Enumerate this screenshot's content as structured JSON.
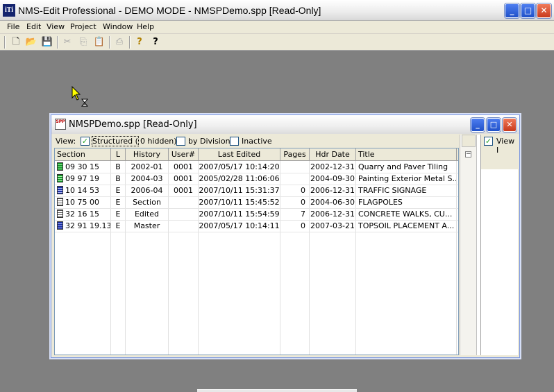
{
  "window": {
    "title": "NMS-Edit Professional - DEMO MODE - NMSPDemo.spp [Read-Only]",
    "app_icon_text": "iTi",
    "minimize": "_",
    "maximize": "□",
    "close": "✕"
  },
  "menu": [
    "File",
    "Edit",
    "View",
    "Project",
    "Window",
    "Help"
  ],
  "toolbar": {
    "new": "🗋",
    "open": "📂",
    "save": "💾",
    "cut": "✂",
    "copy": "⎘",
    "paste": "📋",
    "print": "⎙",
    "help": "?",
    "context_help": "?"
  },
  "child": {
    "title": "NMSPDemo.spp [Read-Only]",
    "icon_text": "SPP",
    "minimize": "_",
    "maximize": "□",
    "close": "✕",
    "filter": {
      "view_label": "View:",
      "structured_label": "Structured (",
      "hidden_count": "0 hidden)",
      "by_division_label": "by Division",
      "inactive_label": "Inactive",
      "structured_checked": "✓",
      "by_division_checked": "",
      "inactive_checked": ""
    },
    "right_pane": {
      "view_label": "View I",
      "checked": "✓"
    },
    "collapse": "−"
  },
  "grid": {
    "columns": [
      "Section",
      "L",
      "History",
      "User#",
      "Last Edited",
      "Pages",
      "Hdr Date",
      "Title"
    ],
    "rows": [
      {
        "icon": "green",
        "section": "09 30 15",
        "level": "B",
        "history": "2002-01",
        "user": "0001",
        "last_edited": "2007/05/17  10:14:20",
        "pages": "",
        "hdr_date": "2002-12-31",
        "title": "Quarry and Paver Tiling"
      },
      {
        "icon": "green",
        "section": "09 97 19",
        "level": "B",
        "history": "2004-03",
        "user": "0001",
        "last_edited": "2005/02/28  11:06:06",
        "pages": "",
        "hdr_date": "2004-09-30",
        "title": "Painting Exterior Metal S..."
      },
      {
        "icon": "blue",
        "section": "10 14 53",
        "level": "E",
        "history": "2006-04",
        "user": "0001",
        "last_edited": "2007/10/11  15:31:37",
        "pages": "0",
        "hdr_date": "2006-12-31",
        "title": "TRAFFIC SIGNAGE"
      },
      {
        "icon": "white",
        "section": "10 75 00",
        "level": "E",
        "history": "Section",
        "user": "",
        "last_edited": "2007/10/11  15:45:52",
        "pages": "0",
        "hdr_date": "2004-06-30",
        "title": "FLAGPOLES"
      },
      {
        "icon": "white",
        "section": "32 16 15",
        "level": "E",
        "history": "Edited",
        "user": "",
        "last_edited": "2007/10/11  15:54:59",
        "pages": "7",
        "hdr_date": "2006-12-31",
        "title": "CONCRETE WALKS, CU..."
      },
      {
        "icon": "blue",
        "section": "32 91 19.13",
        "level": "E",
        "history": "Master",
        "user": "",
        "last_edited": "2007/05/17  10:14:11",
        "pages": "0",
        "hdr_date": "2007-03-21",
        "title": "TOPSOIL PLACEMENT A..."
      }
    ]
  }
}
